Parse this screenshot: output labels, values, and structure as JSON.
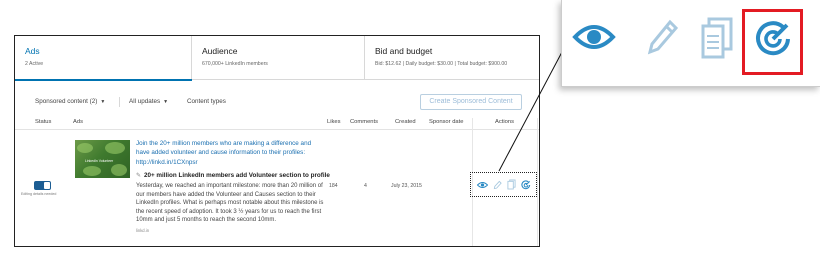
{
  "tabs": [
    {
      "title": "Ads",
      "subtitle": "2 Active"
    },
    {
      "title": "Audience",
      "subtitle": "670,000+ LinkedIn members"
    },
    {
      "title": "Bid and budget",
      "subtitle": "Bid: $12.62 | Daily budget: $30.00 | Total budget: $900.00"
    }
  ],
  "filters": {
    "content_label": "Sponsored content (2)",
    "updates_label": "All updates",
    "types_label": "Content types",
    "create_button": "Create Sponsored Content"
  },
  "table": {
    "headers": [
      "Status",
      "Ads",
      "Likes",
      "Comments",
      "Created",
      "Sponsor date",
      "Actions"
    ],
    "row": {
      "status_text": "Editing details needed",
      "thumbnail_label": "LinkedIn Volunteer",
      "headline": "Join the 20+ million members who are making a difference and have added volunteer and cause information to their profiles:",
      "link": "http://linkd.in/1CXnpsr",
      "title": "20+ million LinkedIn members add Volunteer section to profile",
      "body": "Yesterday, we reached an important milestone: more than 20 million of our members have added the Volunteer and Causes section to their LinkedIn profiles. What is perhaps most notable about this milestone is the recent speed of adoption. It took 3 ½ years for us to reach the first 10mm and just 5 months to reach the second 10mm.",
      "source": "linkd.in",
      "likes": "184",
      "comments": "4",
      "created": "July 23, 2015",
      "sponsor_date": ""
    }
  },
  "action_icons": [
    "eye-icon",
    "pencil-icon",
    "document-icon",
    "sponsor-target-icon"
  ],
  "colors": {
    "accent": "#0073b1",
    "icon_blue": "#2a8ac4",
    "icon_light": "#a9c9df",
    "highlight_red": "#e31b23",
    "toggle": "#1c5d93"
  }
}
